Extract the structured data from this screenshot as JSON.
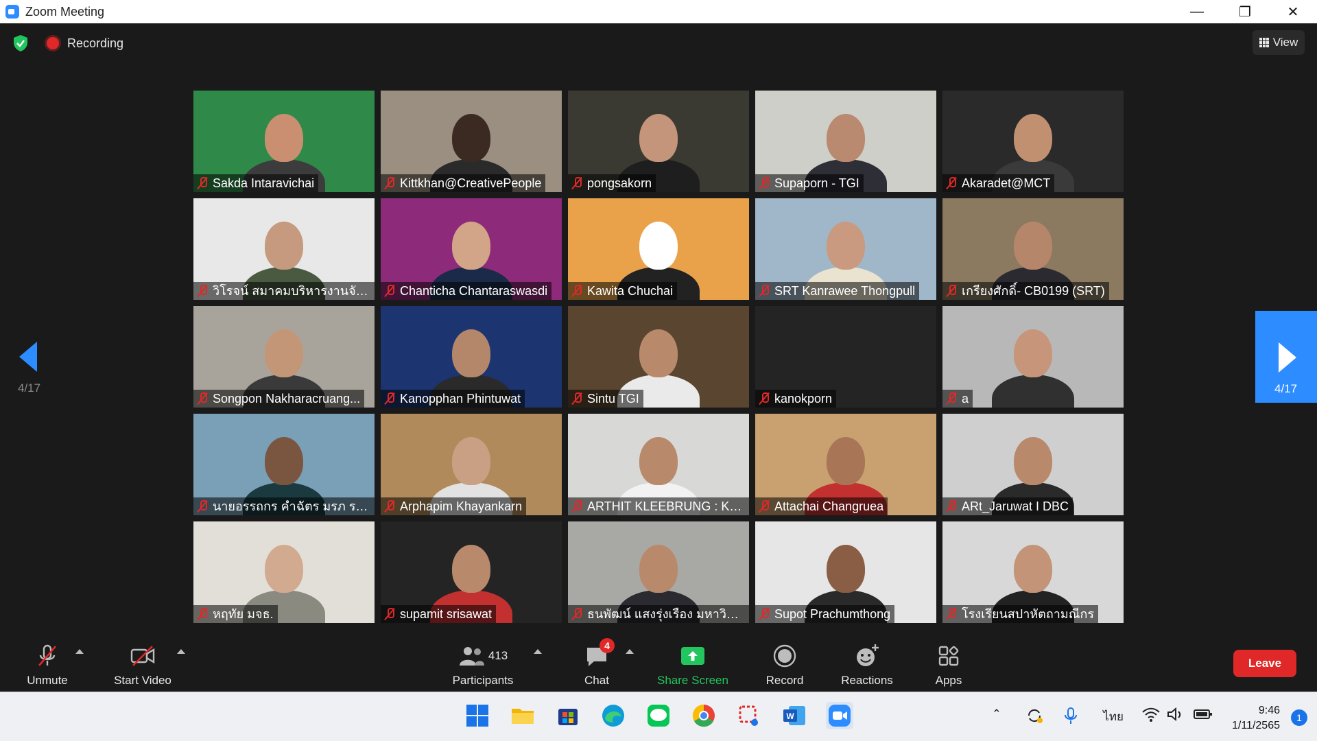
{
  "window": {
    "title": "Zoom Meeting"
  },
  "topbar": {
    "recording_label": "Recording",
    "view_label": "View"
  },
  "pagination": {
    "left": "4/17",
    "right": "4/17"
  },
  "participants_tiles": [
    {
      "name": "Sakda Intaravichai",
      "bg": "#2f8a4a",
      "face": "#c98f70",
      "shirt": "#3c3c3c"
    },
    {
      "name": "Kittkhan@CreativePeople",
      "bg": "#9a8f80",
      "face": "#3b2a22",
      "shirt": "#2a2a2a"
    },
    {
      "name": "pongsakorn",
      "bg": "#3a3a32",
      "face": "#c4957a",
      "shirt": "#1e1e1e"
    },
    {
      "name": "Supaporn - TGI",
      "bg": "#cfcfc9",
      "face": "#b98a70",
      "shirt": "#2e2e36"
    },
    {
      "name": "Akaradet@MCT",
      "bg": "#2a2a2a",
      "face": "#c09070",
      "shirt": "#3a3a3a"
    },
    {
      "name": "วิโรจน์ สมาคมบริหารงานจัดซื้...",
      "bg": "#e8e8e8",
      "face": "#c59a7e",
      "shirt": "#4a5a40"
    },
    {
      "name": "Chanticha Chantaraswasdi",
      "bg": "#8e2a7a",
      "face": "#d2a488",
      "shirt": "#1c2a4a"
    },
    {
      "name": "Kawita Chuchai",
      "bg": "#e9a24a",
      "face": "#ffffff",
      "shirt": "#222222"
    },
    {
      "name": "SRT Kanrawee Thongpull",
      "bg": "#9fb7c8",
      "face": "#c99a80",
      "shirt": "#e9e3d0"
    },
    {
      "name": "เกรียงศักดิ์- CB0199 (SRT)",
      "bg": "#8b7a60",
      "face": "#b5866a",
      "shirt": "#2a2a30"
    },
    {
      "name": "Songpon Nakharacruang...",
      "bg": "#a8a49c",
      "face": "#c39678",
      "shirt": "#3a3a3a"
    },
    {
      "name": "Kanopphan Phintuwat",
      "bg": "#1c3470",
      "face": "#b4866a",
      "shirt": "#2a2a2a"
    },
    {
      "name": "Sintu TGI",
      "bg": "#5a4630",
      "face": "#b9896c",
      "shirt": "#eaeaea"
    },
    {
      "name": "kanokporn",
      "bg": "#242424",
      "face": "",
      "shirt": ""
    },
    {
      "name": "a",
      "bg": "#b8b8b8",
      "face": "#c7957a",
      "shirt": "#303030"
    },
    {
      "name": "นายอรรถกร คำฉัตร มรภ ราไ...",
      "bg": "#7aa0b8",
      "face": "#7a5640",
      "shirt": "#1a3a40"
    },
    {
      "name": "Arphapim Khayankarn",
      "bg": "#b08a5a",
      "face": "#c9a084",
      "shirt": "#e2e2e2"
    },
    {
      "name": "ARTHIT  KLEEBRUNG : KVC",
      "bg": "#d8d8d6",
      "face": "#b9896c",
      "shirt": "#f2f2f2"
    },
    {
      "name": "Attachai Changruea",
      "bg": "#c9a070",
      "face": "#a87656",
      "shirt": "#c23030"
    },
    {
      "name": "ARt_Jaruwat I DBC",
      "bg": "#cfcfcf",
      "face": "#b9896c",
      "shirt": "#2a2a2a"
    },
    {
      "name": "หฤทัย มจธ.",
      "bg": "#e2dfd8",
      "face": "#d2aa90",
      "shirt": "#8a8a80"
    },
    {
      "name": "supamit srisawat",
      "bg": "#242424",
      "face": "#b9896c",
      "shirt": "#c23030"
    },
    {
      "name": "ธนพัฒน์ แสงรุ่งเรือง  มหาวิทย...",
      "bg": "#a8a8a4",
      "face": "#b9896c",
      "shirt": "#2a2a30"
    },
    {
      "name": "Supot Prachumthong",
      "bg": "#e6e6e6",
      "face": "#8a5e44",
      "shirt": "#2a2a2a"
    },
    {
      "name": "โรงเรียนสปาหัตถามณีกร",
      "bg": "#d8d8d8",
      "face": "#c49478",
      "shirt": "#222222"
    }
  ],
  "toolbar": {
    "unmute": "Unmute",
    "start_video": "Start Video",
    "participants_count": "413",
    "participants": "Participants",
    "chat": "Chat",
    "chat_badge": "4",
    "share_screen": "Share Screen",
    "record": "Record",
    "reactions": "Reactions",
    "apps": "Apps",
    "leave": "Leave"
  },
  "taskbar": {
    "lang": "ไทย",
    "time": "9:46",
    "date": "1/11/2565",
    "notif_count": "1"
  },
  "colors": {
    "accent": "#2d8cff",
    "danger": "#e02828",
    "share_green": "#22c55e"
  }
}
